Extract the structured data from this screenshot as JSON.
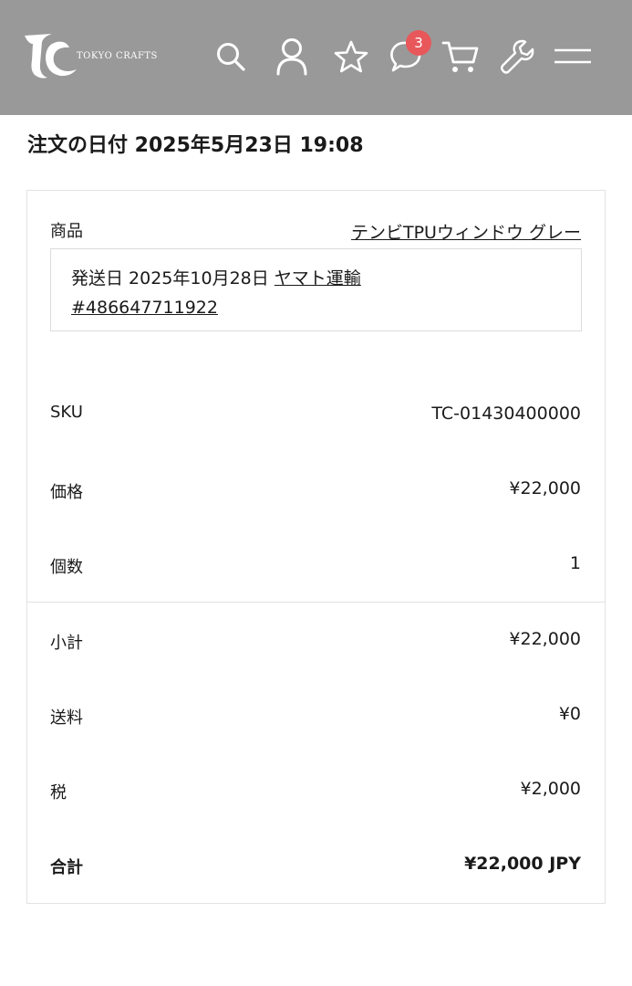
{
  "header": {
    "brand": "TOKYO CRAFTS",
    "notification_count": "3",
    "bg_color": "#999999",
    "badge_color": "#e8575a",
    "icons": [
      "search-icon",
      "user-icon",
      "star-icon",
      "chat-icon",
      "cart-icon",
      "wrench-icon",
      "menu-icon"
    ]
  },
  "order": {
    "date_label": "注文の日付 2025年5月23日 19:08"
  },
  "item": {
    "product_label": "商品",
    "product_name": "テンビTPUウィンドウ グレー",
    "shipping_prefix": "発送日 2025年10月28日 ",
    "carrier": "ヤマト運輸",
    "tracking": "#486647711922",
    "sku_label": "SKU",
    "sku": "TC-01430400000",
    "price_label": "価格",
    "price": "¥22,000",
    "qty_label": "個数",
    "qty": "1"
  },
  "summary": {
    "subtotal_label": "小計",
    "subtotal": "¥22,000",
    "shipping_label": "送料",
    "shipping": "¥0",
    "tax_label": "税",
    "tax": "¥2,000",
    "total_label": "合計",
    "total": "¥22,000 JPY"
  }
}
